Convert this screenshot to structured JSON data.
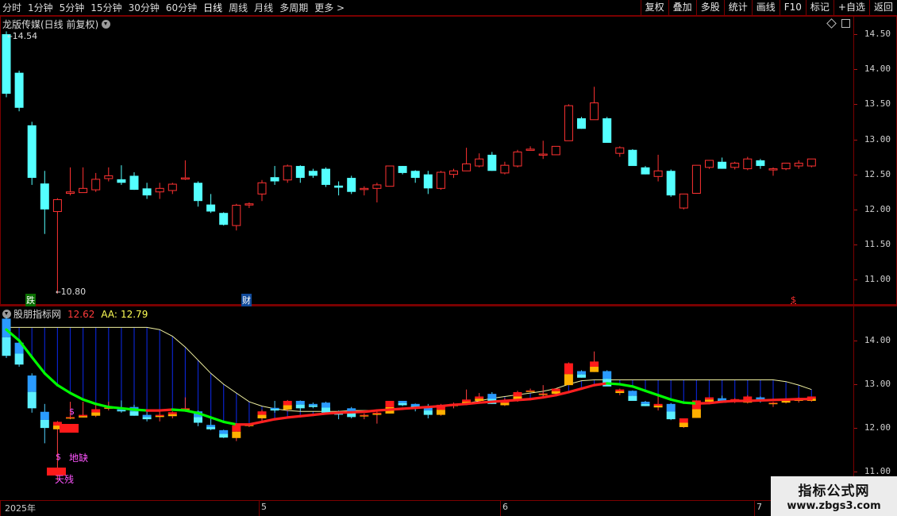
{
  "toolbar": {
    "left": [
      {
        "label": "分时",
        "name": "tab-fenshi"
      },
      {
        "label": "1分钟",
        "name": "tab-1min"
      },
      {
        "label": "5分钟",
        "name": "tab-5min"
      },
      {
        "label": "15分钟",
        "name": "tab-15min"
      },
      {
        "label": "30分钟",
        "name": "tab-30min"
      },
      {
        "label": "60分钟",
        "name": "tab-60min"
      },
      {
        "label": "日线",
        "name": "tab-daily",
        "active": true
      },
      {
        "label": "周线",
        "name": "tab-weekly"
      },
      {
        "label": "月线",
        "name": "tab-monthly"
      },
      {
        "label": "多周期",
        "name": "tab-multi"
      },
      {
        "label": "更多 >",
        "name": "tab-more"
      }
    ],
    "right": [
      {
        "label": "复权",
        "name": "fuquan-button"
      },
      {
        "label": "叠加",
        "name": "overlay-button"
      },
      {
        "label": "多股",
        "name": "multi-stock-button"
      },
      {
        "label": "统计",
        "name": "stats-button"
      },
      {
        "label": "画线",
        "name": "draw-line-button"
      },
      {
        "label": "F10",
        "name": "f10-button"
      },
      {
        "label": "标记",
        "name": "mark-button"
      },
      {
        "label": "+自选",
        "name": "add-watchlist-button"
      },
      {
        "label": "返回",
        "name": "back-button"
      }
    ]
  },
  "main_pane": {
    "title": "龙版传媒(日线 前复权)",
    "high_label": "14.54",
    "low_label": "10.80",
    "tag_die": "跌",
    "tag_cai": "财",
    "tag_dollar": "$",
    "axis_labels": [
      "14.50",
      "14.00",
      "13.50",
      "13.00",
      "12.50",
      "12.00",
      "11.50",
      "11.00"
    ]
  },
  "sub_pane": {
    "title": "股朋指标网",
    "value1": "12.62",
    "aa_label": "AA:",
    "aa_value": "12.79",
    "axis_labels": [
      "14.00",
      "13.00",
      "12.00",
      "11.00"
    ],
    "ann_dollar1": "$",
    "ann_dollar2": "$",
    "ann_dique": "地缺",
    "ann_tiancan": "天残"
  },
  "date_axis": [
    "2025年",
    "5",
    "6",
    "7"
  ],
  "watermark": {
    "line1": "指标公式网",
    "line2": "www.zbgs3.com"
  },
  "colors": {
    "up": "#ff3232",
    "down": "#54ffff",
    "frame": "#7a0000",
    "green": "#00ff00",
    "fill": "#0a23c8"
  },
  "chart_data": {
    "type": "candlestick",
    "ohlc": [
      [
        14.5,
        14.54,
        13.6,
        13.65
      ],
      [
        13.95,
        13.98,
        13.4,
        13.45
      ],
      [
        13.2,
        13.25,
        12.35,
        12.45
      ],
      [
        12.37,
        12.55,
        11.65,
        12.0
      ],
      [
        11.97,
        12.16,
        10.8,
        12.14
      ],
      [
        12.23,
        12.6,
        12.2,
        12.25
      ],
      [
        12.24,
        12.6,
        12.24,
        12.3
      ],
      [
        12.28,
        12.52,
        12.25,
        12.43
      ],
      [
        12.44,
        12.6,
        12.4,
        12.48
      ],
      [
        12.43,
        12.63,
        12.35,
        12.38
      ],
      [
        12.48,
        12.53,
        12.28,
        12.28
      ],
      [
        12.3,
        12.38,
        12.15,
        12.2
      ],
      [
        12.25,
        12.38,
        12.15,
        12.3
      ],
      [
        12.27,
        12.38,
        12.22,
        12.36
      ],
      [
        12.45,
        12.7,
        12.42,
        12.45
      ],
      [
        12.38,
        12.4,
        12.04,
        12.12
      ],
      [
        12.07,
        12.22,
        11.95,
        11.97
      ],
      [
        11.95,
        11.96,
        11.77,
        11.78
      ],
      [
        11.77,
        12.08,
        11.7,
        12.06
      ],
      [
        12.07,
        12.1,
        12.02,
        12.08
      ],
      [
        12.22,
        12.42,
        12.12,
        12.38
      ],
      [
        12.46,
        12.62,
        12.35,
        12.4
      ],
      [
        12.42,
        12.64,
        12.38,
        12.62
      ],
      [
        12.62,
        12.63,
        12.38,
        12.45
      ],
      [
        12.55,
        12.58,
        12.45,
        12.48
      ],
      [
        12.58,
        12.6,
        12.32,
        12.35
      ],
      [
        12.34,
        12.4,
        12.2,
        12.31
      ],
      [
        12.45,
        12.48,
        12.22,
        12.25
      ],
      [
        12.3,
        12.33,
        12.2,
        12.3
      ],
      [
        12.3,
        12.38,
        12.1,
        12.35
      ],
      [
        12.33,
        12.62,
        12.33,
        12.62
      ],
      [
        12.62,
        12.62,
        12.5,
        12.52
      ],
      [
        12.55,
        12.56,
        12.38,
        12.45
      ],
      [
        12.5,
        12.55,
        12.22,
        12.3
      ],
      [
        12.3,
        12.55,
        12.28,
        12.53
      ],
      [
        12.5,
        12.58,
        12.45,
        12.55
      ],
      [
        12.55,
        12.88,
        12.55,
        12.65
      ],
      [
        12.62,
        12.8,
        12.6,
        12.72
      ],
      [
        12.78,
        12.82,
        12.55,
        12.55
      ],
      [
        12.52,
        12.68,
        12.5,
        12.63
      ],
      [
        12.62,
        12.85,
        12.6,
        12.82
      ],
      [
        12.86,
        12.9,
        12.86,
        12.86
      ],
      [
        12.78,
        12.98,
        12.72,
        12.79
      ],
      [
        12.78,
        12.9,
        12.78,
        12.9
      ],
      [
        12.98,
        13.5,
        12.98,
        13.48
      ],
      [
        13.3,
        13.32,
        13.15,
        13.15
      ],
      [
        13.28,
        13.75,
        13.28,
        13.52
      ],
      [
        13.3,
        13.32,
        12.96,
        12.95
      ],
      [
        12.8,
        12.9,
        12.75,
        12.88
      ],
      [
        12.85,
        12.86,
        12.64,
        12.62
      ],
      [
        12.6,
        12.62,
        12.5,
        12.5
      ],
      [
        12.47,
        12.78,
        12.4,
        12.55
      ],
      [
        12.55,
        12.57,
        12.18,
        12.2
      ],
      [
        12.02,
        12.22,
        12.0,
        12.22
      ],
      [
        12.23,
        12.63,
        12.23,
        12.63
      ],
      [
        12.6,
        12.7,
        12.58,
        12.7
      ],
      [
        12.68,
        12.74,
        12.58,
        12.58
      ],
      [
        12.6,
        12.68,
        12.57,
        12.66
      ],
      [
        12.58,
        12.75,
        12.56,
        12.72
      ],
      [
        12.7,
        12.72,
        12.58,
        12.62
      ],
      [
        12.58,
        12.6,
        12.48,
        12.58
      ],
      [
        12.58,
        12.66,
        12.56,
        12.66
      ],
      [
        12.62,
        12.7,
        12.58,
        12.66
      ],
      [
        12.62,
        12.72,
        12.6,
        12.72
      ]
    ],
    "ma_white": [
      14.3,
      14.3,
      14.3,
      14.3,
      14.3,
      14.3,
      14.3,
      14.3,
      14.3,
      14.3,
      14.3,
      14.3,
      14.25,
      14.1,
      13.85,
      13.55,
      13.25,
      13.0,
      12.8,
      12.6,
      12.5,
      12.44,
      12.4,
      12.38,
      12.38,
      12.38,
      12.38,
      12.4,
      12.4,
      12.4,
      12.42,
      12.44,
      12.46,
      12.48,
      12.5,
      12.52,
      12.56,
      12.62,
      12.68,
      12.72,
      12.76,
      12.8,
      12.84,
      12.9,
      13.0,
      13.08,
      13.1,
      13.1,
      13.1,
      13.1,
      13.1,
      13.1,
      13.1,
      13.1,
      13.1,
      13.1,
      13.1,
      13.1,
      13.1,
      13.1,
      13.1,
      13.06,
      12.98,
      12.88
    ],
    "ma_color": [
      14.25,
      14.0,
      13.62,
      13.25,
      12.98,
      12.8,
      12.65,
      12.55,
      12.48,
      12.45,
      12.42,
      12.4,
      12.4,
      12.42,
      12.4,
      12.34,
      12.24,
      12.14,
      12.08,
      12.08,
      12.14,
      12.2,
      12.24,
      12.27,
      12.3,
      12.33,
      12.35,
      12.36,
      12.37,
      12.4,
      12.42,
      12.44,
      12.46,
      12.48,
      12.5,
      12.53,
      12.55,
      12.58,
      12.6,
      12.62,
      12.64,
      12.66,
      12.7,
      12.75,
      12.82,
      12.9,
      12.98,
      13.02,
      13.0,
      12.95,
      12.85,
      12.75,
      12.65,
      12.58,
      12.56,
      12.57,
      12.6,
      12.62,
      12.62,
      12.63,
      12.64,
      12.65,
      12.66,
      12.66
    ],
    "main_ylim": [
      10.65,
      14.75
    ],
    "sub_ylim": [
      10.35,
      14.78
    ]
  }
}
